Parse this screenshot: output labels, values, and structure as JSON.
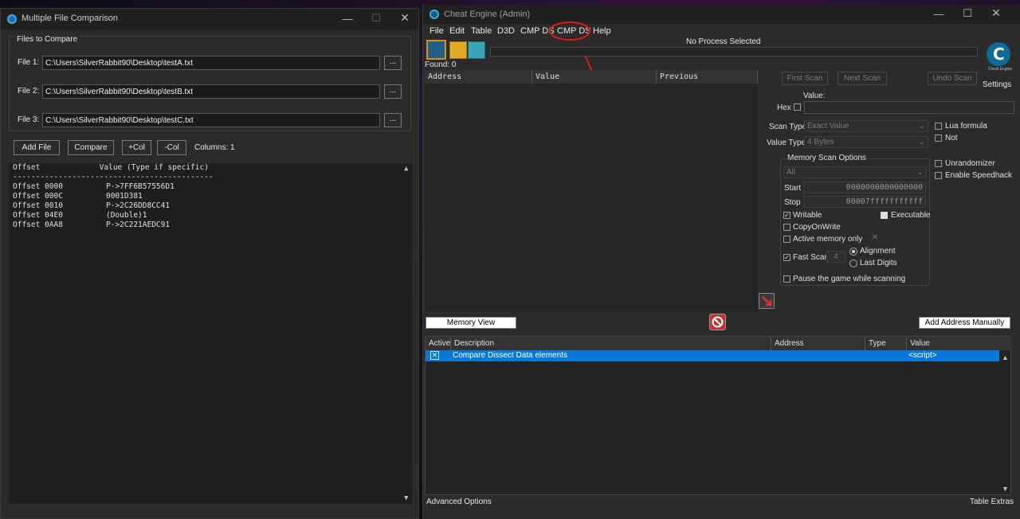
{
  "left_window": {
    "title": "Multiple File Comparison",
    "group_title": "Files to Compare",
    "files": [
      {
        "label": "File 1:",
        "path": "C:\\Users\\SilverRabbit90\\Desktop\\testA.txt",
        "browse": "..."
      },
      {
        "label": "File 2:",
        "path": "C:\\Users\\SilverRabbit90\\Desktop\\testB.txt",
        "browse": "..."
      },
      {
        "label": "File 3:",
        "path": "C:\\Users\\SilverRabbit90\\Desktop\\testC.txt",
        "browse": "..."
      }
    ],
    "buttons": {
      "add_file": "Add File",
      "compare": "Compare",
      "add_col": "+Col",
      "remove_col": "-Col"
    },
    "columns_text": "Columns: 1",
    "output": {
      "header": "Offset             Value (Type if specific)",
      "divider": "--------------------------------------------",
      "rows": [
        {
          "offset": "Offset 0000",
          "value": "P->7FF6B57556D1"
        },
        {
          "offset": "Offset 000C",
          "value": "0001D381"
        },
        {
          "offset": "Offset 0010",
          "value": "P->2C26DD8CC41"
        },
        {
          "offset": "Offset 04E0",
          "value": "(Double)1"
        },
        {
          "offset": "Offset 0AA8",
          "value": "P->2C221AEDC91"
        }
      ]
    }
  },
  "ce": {
    "title": "Cheat Engine (Admin)",
    "menu": [
      "File",
      "Edit",
      "Table",
      "D3D",
      "CMP DS",
      "CMP DS",
      "Help"
    ],
    "process_text": "No Process Selected",
    "found": "Found: 0",
    "columns": [
      "Address",
      "Value",
      "Previous"
    ],
    "scan": {
      "first_scan": "First Scan",
      "next_scan": "Next Scan",
      "undo_scan": "Undo Scan",
      "settings": "Settings",
      "logo_caption": "Cheat Engine",
      "value_label": "Value:",
      "hex_label": "Hex",
      "scan_type_label": "Scan Type",
      "scan_type_value": "Exact Value",
      "value_type_label": "Value Type",
      "value_type_value": "4 Bytes",
      "lua_formula": "Lua formula",
      "not": "Not",
      "memory_scan_options": "Memory Scan Options",
      "region": "All",
      "start_label": "Start",
      "start_value": "0000000000000000",
      "stop_label": "Stop",
      "stop_value": "00007fffffffffff",
      "writable": "Writable",
      "executable": "Executable",
      "copy_on_write": "CopyOnWrite",
      "active_memory_only": "Active memory only",
      "fast_scan": "Fast Scan",
      "fast_scan_value": "4",
      "alignment": "Alignment",
      "last_digits": "Last Digits",
      "pause_game": "Pause the game while scanning",
      "unrandomizer": "Unrandomizer",
      "enable_speedhack": "Enable Speedhack"
    },
    "memory_view": "Memory View",
    "add_address_manually": "Add Address Manually",
    "table_columns": [
      "Active",
      "Description",
      "Address",
      "Type",
      "Value"
    ],
    "table_rows": [
      {
        "active": "✕",
        "description": "Compare Dissect Data elements",
        "address": "",
        "type": "",
        "value": "<script>"
      }
    ],
    "advanced_options": "Advanced Options",
    "table_extras": "Table Extras"
  }
}
